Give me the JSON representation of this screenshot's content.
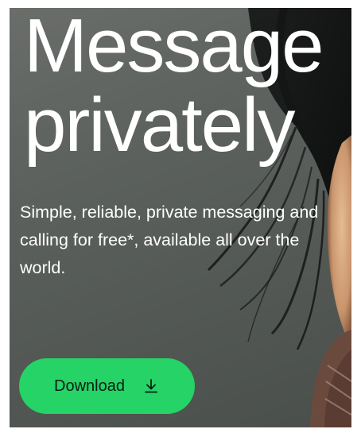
{
  "hero": {
    "headline_line1": "Message",
    "headline_line2": "privately",
    "subtext": "Simple, reliable, private messaging and calling for free*, available all over the world."
  },
  "cta": {
    "download_label": "Download",
    "icon": "download-icon"
  },
  "colors": {
    "button_bg": "#25d366",
    "button_text": "#0b1f16",
    "text": "#ffffff"
  }
}
